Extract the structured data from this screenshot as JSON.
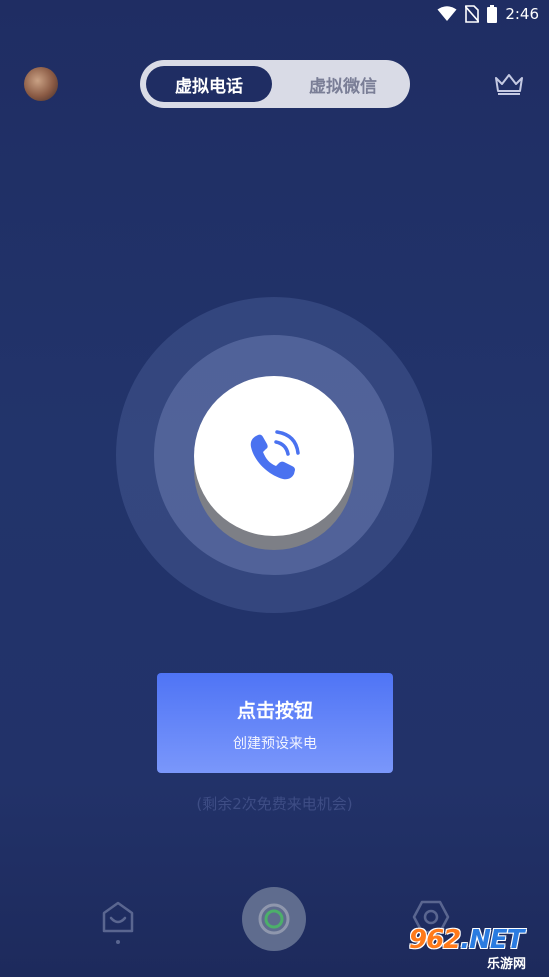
{
  "status_bar": {
    "time": "2:46",
    "icons": [
      "wifi-icon",
      "no-sim-icon",
      "battery-icon"
    ]
  },
  "header": {
    "avatar": "avatar",
    "vip": "crown-icon",
    "tabs": [
      {
        "label": "虚拟电话",
        "active": true
      },
      {
        "label": "虚拟微信",
        "active": false
      }
    ]
  },
  "main": {
    "call_icon": "phone-ringing-icon",
    "cta_title": "点击按钮",
    "cta_subtitle": "创建预设来电",
    "remaining": "(剩余2次免费来电机会)"
  },
  "bottom_nav": {
    "items": [
      "home-icon",
      "record-icon",
      "settings-icon"
    ]
  },
  "watermark": {
    "brand_main": "962",
    "brand_suffix": ".NET",
    "brand_sub": "乐游网"
  },
  "colors": {
    "background": "#22346b",
    "accent": "#4f74f5",
    "icon_blue": "#4a72f0"
  }
}
